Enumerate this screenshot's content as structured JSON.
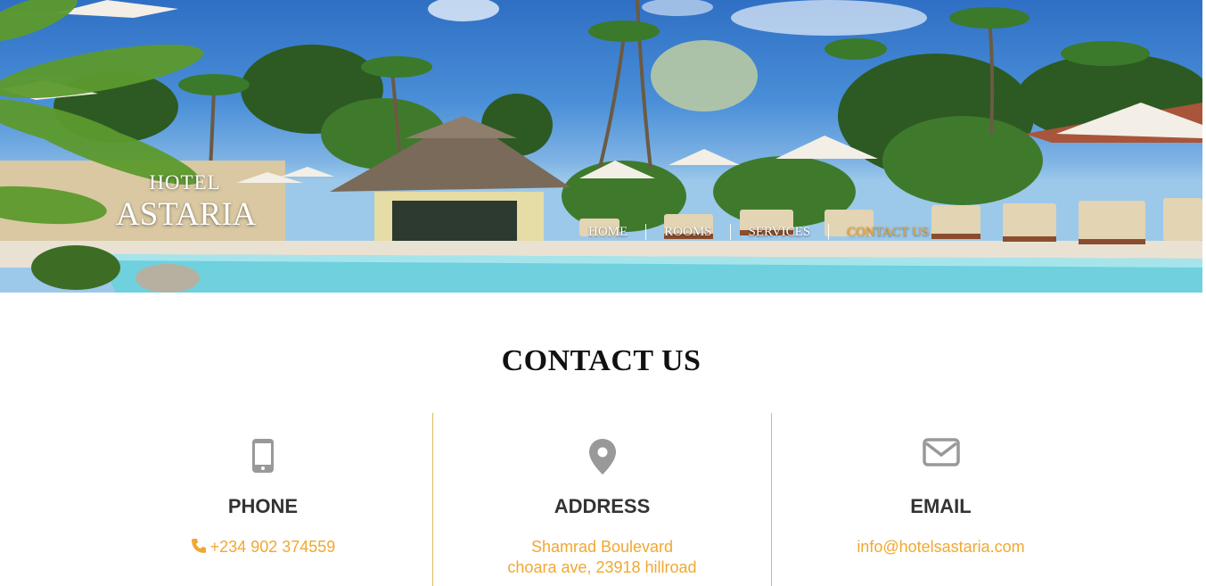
{
  "brand": {
    "line1": "HOTEL",
    "line2": "ASTARIA"
  },
  "nav": {
    "items": [
      {
        "label": "HOME",
        "active": false
      },
      {
        "label": "ROOMS",
        "active": false
      },
      {
        "label": "SERVICES",
        "active": false
      },
      {
        "label": "CONTACT US",
        "active": true
      }
    ]
  },
  "contact": {
    "title": "CONTACT US",
    "phone": {
      "icon": "mobile-phone-icon",
      "heading": "PHONE",
      "value": "+234 902 374559",
      "value_icon": "phone-icon"
    },
    "address": {
      "icon": "map-marker-icon",
      "heading": "ADDRESS",
      "line1": "Shamrad Boulevard",
      "line2": "choara ave, 23918 hillroad"
    },
    "email": {
      "icon": "envelope-icon",
      "heading": "EMAIL",
      "value": "info@hotelsastaria.com"
    }
  },
  "colors": {
    "accent": "#f0a830",
    "divider": "#e2b86a",
    "icon_gray": "#999999",
    "heading": "#333333"
  }
}
